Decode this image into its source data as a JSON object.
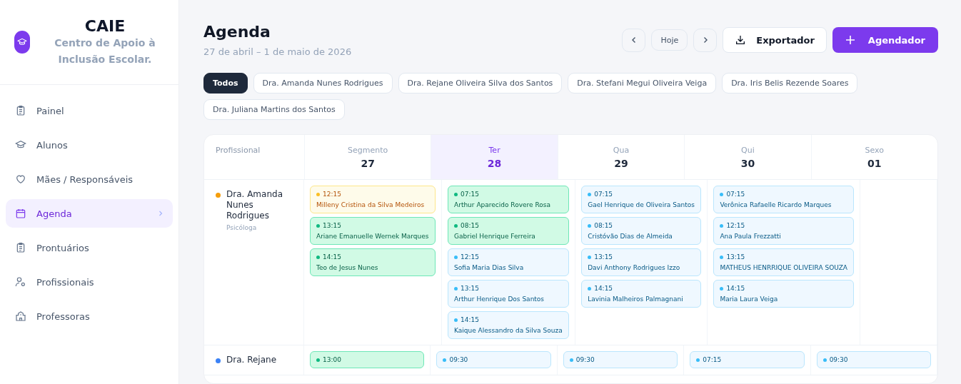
{
  "brand": {
    "name": "CAIE",
    "subtitle": "Centro de Apoio à Inclusão Escolar."
  },
  "nav": [
    {
      "label": "Painel",
      "kind": "clipboard",
      "selected": false
    },
    {
      "label": "Alunos",
      "kind": "cap",
      "selected": false
    },
    {
      "label": "Mães / Responsáveis",
      "kind": "heart",
      "selected": false
    },
    {
      "label": "Agenda",
      "kind": "calendar",
      "selected": true
    },
    {
      "label": "Prontuários",
      "kind": "clipboard",
      "selected": false
    },
    {
      "label": "Profissionais",
      "kind": "users",
      "selected": false
    },
    {
      "label": "Professoras",
      "kind": "building",
      "selected": false
    }
  ],
  "header": {
    "title": "Agenda",
    "range": "27 de abril – 1 de maio de 2026",
    "today": "Hoje",
    "export": "Exportador",
    "schedule": "Agendador"
  },
  "filters": [
    {
      "label": "Todos",
      "selected": true
    },
    {
      "label": "Dra. Amanda Nunes Rodrigues",
      "selected": false
    },
    {
      "label": "Dra. Rejane Oliveira Silva dos Santos",
      "selected": false
    },
    {
      "label": "Dra. Stefani Megui Oliveira Veiga",
      "selected": false
    },
    {
      "label": "Dra. Iris Belis Rezende Soares",
      "selected": false
    },
    {
      "label": "Dra. Juliana Martins dos Santos",
      "selected": false
    }
  ],
  "calendar": {
    "corner": "Profissional",
    "days": [
      {
        "name": "Segmento",
        "date": "27",
        "selected": false
      },
      {
        "name": "Ter",
        "date": "28",
        "selected": true
      },
      {
        "name": "Qua",
        "date": "29",
        "selected": false
      },
      {
        "name": "Qui",
        "date": "30",
        "selected": false
      },
      {
        "name": "Sexo",
        "date": "01",
        "selected": false
      }
    ],
    "rows": [
      {
        "name": "Dra. Amanda Nunes Rodrigues",
        "role": "Psicóloga",
        "color": "#f59e0b",
        "days": [
          [
            {
              "time": "12:15",
              "patient": "Milleny Cristina da Silva Medeiros",
              "color": "#fbbf24"
            },
            {
              "time": "13:15",
              "patient": "Ariane Emanuelle Wernek Marques",
              "color": "#10b981"
            },
            {
              "time": "14:15",
              "patient": "Teo de Jesus Nunes",
              "color": "#10b981"
            }
          ],
          [
            {
              "time": "07:15",
              "patient": "Arthur Aparecido Rovere Rosa",
              "color": "#10b981"
            },
            {
              "time": "08:15",
              "patient": "Gabriel Henrique Ferreira",
              "color": "#10b981"
            },
            {
              "time": "12:15",
              "patient": "Sofia Maria Dias Silva",
              "color": "#38bdf8"
            },
            {
              "time": "13:15",
              "patient": "Arthur Henrique Dos Santos",
              "color": "#38bdf8"
            },
            {
              "time": "14:15",
              "patient": "Kaique Alessandro da Silva Souza",
              "color": "#38bdf8"
            }
          ],
          [
            {
              "time": "07:15",
              "patient": "Gael Henrique de Oliveira Santos",
              "color": "#38bdf8"
            },
            {
              "time": "08:15",
              "patient": "Cristóvão Dias de Almeida",
              "color": "#38bdf8"
            },
            {
              "time": "13:15",
              "patient": "Davi Anthony Rodrigues Izzo",
              "color": "#38bdf8"
            },
            {
              "time": "14:15",
              "patient": "Lavinia Malheiros Palmagnani",
              "color": "#38bdf8"
            }
          ],
          [
            {
              "time": "07:15",
              "patient": "Verônica Rafaelle Ricardo Marques",
              "color": "#38bdf8"
            },
            {
              "time": "12:15",
              "patient": "Ana Paula Frezzatti",
              "color": "#38bdf8"
            },
            {
              "time": "13:15",
              "patient": "MATHEUS HENRRIQUE OLIVEIRA SOUZA",
              "color": "#38bdf8"
            },
            {
              "time": "14:15",
              "patient": "Maria Laura Veiga",
              "color": "#38bdf8"
            }
          ]
        ]
      },
      {
        "name": "Dra. Rejane",
        "color": "#3b82f6",
        "days": [
          [
            {
              "time": "13:00",
              "color": "#10b981"
            }
          ],
          [
            {
              "time": "09:30",
              "color": "#38bdf8"
            }
          ],
          [
            {
              "time": "09:30",
              "color": "#38bdf8"
            }
          ],
          [
            {
              "time": "07:15",
              "color": "#38bdf8"
            }
          ],
          [
            {
              "time": "09:30",
              "color": "#38bdf8"
            }
          ]
        ]
      }
    ]
  }
}
